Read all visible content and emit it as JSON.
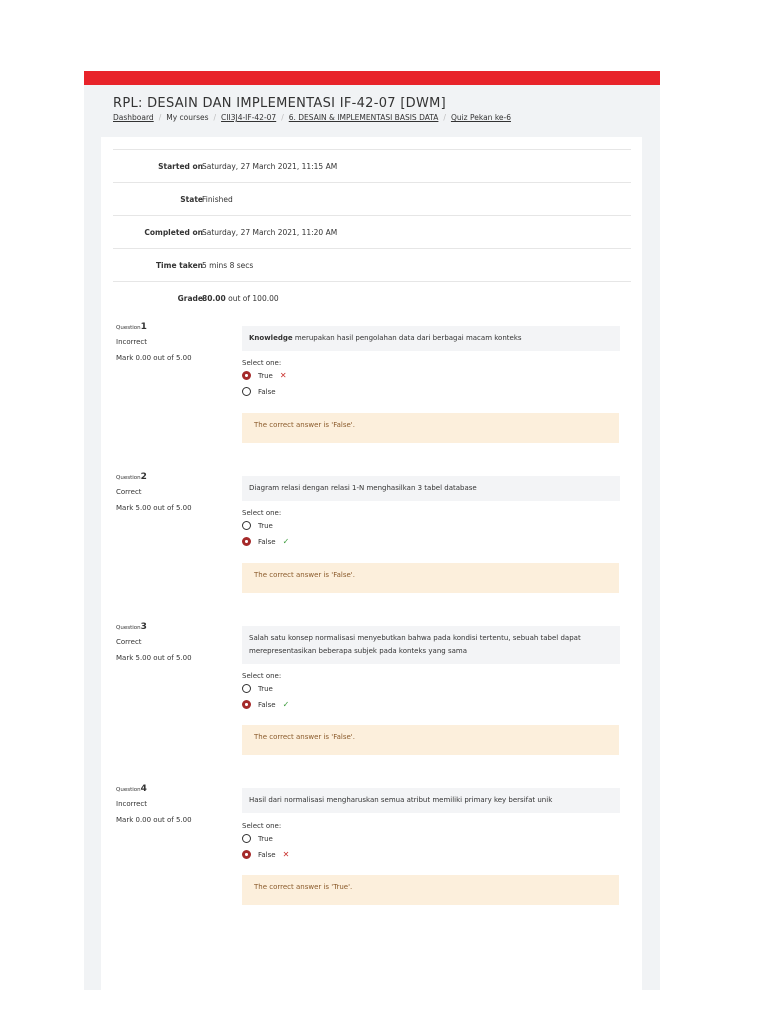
{
  "page": {
    "title": "RPL: DESAIN DAN IMPLEMENTASI IF-42-07 [DWM]",
    "breadcrumb": [
      "Dashboard",
      "My courses",
      "CII3J4-IF-42-07",
      "6. DESAIN & IMPLEMENTASI BASIS DATA",
      "Quiz Pekan ke-6"
    ],
    "accent_color": "#e8232a"
  },
  "summary": {
    "started_label": "Started on",
    "started_value": "Saturday, 27 March 2021, 11:15 AM",
    "state_label": "State",
    "state_value": "Finished",
    "completed_label": "Completed on",
    "completed_value": "Saturday, 27 March 2021, 11:20 AM",
    "time_label": "Time taken",
    "time_value": "5 mins 8 secs",
    "grade_label": "Grade",
    "grade_score": "80.00",
    "grade_rest": "out of 100.00"
  },
  "questions": [
    {
      "label": "Question",
      "number": "1",
      "state": "Incorrect",
      "mark": "Mark 0.00 out of 5.00",
      "text_bold": "Knowledge",
      "text": " merupakan hasil pengolahan data dari berbagai macam konteks",
      "select_label": "Select one:",
      "options": [
        "True",
        "False"
      ],
      "selected": "True",
      "feedback": "The correct answer is 'False'."
    },
    {
      "label": "Question",
      "number": "2",
      "state": "Correct",
      "mark": "Mark 5.00 out of 5.00",
      "text": "Diagram relasi dengan relasi 1-N menghasilkan 3 tabel database",
      "select_label": "Select one:",
      "options": [
        "True",
        "False"
      ],
      "selected": "False",
      "feedback": "The correct answer is 'False'."
    },
    {
      "label": "Question",
      "number": "3",
      "state": "Correct",
      "mark": "Mark 5.00 out of 5.00",
      "text": "Salah satu konsep normalisasi menyebutkan bahwa pada kondisi tertentu, sebuah tabel dapat merepresentasikan beberapa subjek pada konteks yang sama",
      "select_label": "Select one:",
      "options": [
        "True",
        "False"
      ],
      "selected": "False",
      "feedback": "The correct answer is 'False'."
    },
    {
      "label": "Question",
      "number": "4",
      "state": "Incorrect",
      "mark": "Mark 0.00 out of 5.00",
      "text": "Hasil dari normalisasi mengharuskan semua atribut memiliki primary key bersifat unik",
      "select_label": "Select one:",
      "options": [
        "True",
        "False"
      ],
      "selected": "False",
      "feedback": "The correct answer is 'True'."
    }
  ]
}
